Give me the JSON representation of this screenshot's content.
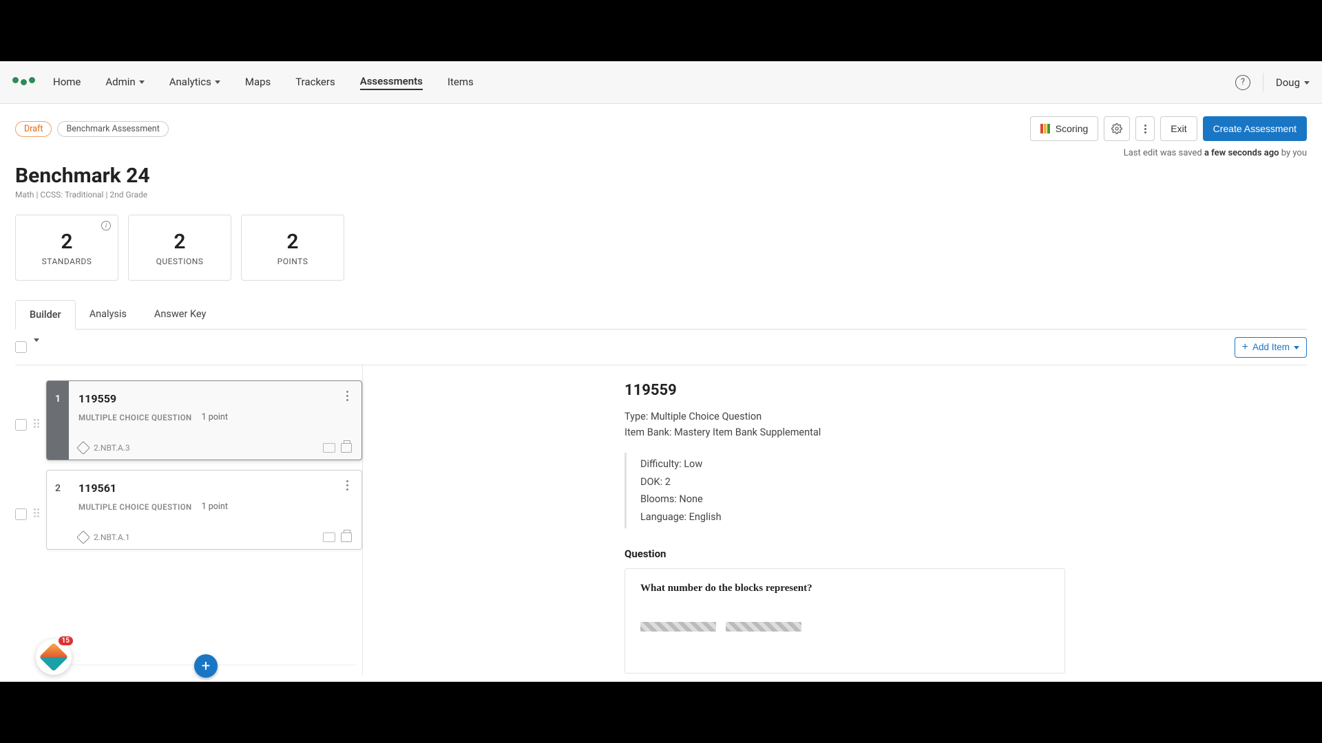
{
  "nav": {
    "items": [
      "Home",
      "Admin",
      "Analytics",
      "Maps",
      "Trackers",
      "Assessments",
      "Items"
    ],
    "dropdown_on": [
      "Admin",
      "Analytics"
    ],
    "active": "Assessments",
    "user": "Doug"
  },
  "actionbar": {
    "draft_label": "Draft",
    "category_label": "Benchmark Assessment",
    "scoring_label": "Scoring",
    "exit_label": "Exit",
    "create_label": "Create Assessment"
  },
  "saved": {
    "prefix": "Last edit was saved ",
    "when": "a few seconds ago",
    "suffix": " by you"
  },
  "header": {
    "title": "Benchmark 24",
    "subtitle": "Math  |  CCSS: Traditional  |  2nd Grade"
  },
  "stats": [
    {
      "value": "2",
      "label": "STANDARDS",
      "info": true
    },
    {
      "value": "2",
      "label": "QUESTIONS",
      "info": false
    },
    {
      "value": "2",
      "label": "POINTS",
      "info": false
    }
  ],
  "tabs": {
    "items": [
      "Builder",
      "Analysis",
      "Answer Key"
    ],
    "active": "Builder"
  },
  "builder": {
    "add_item_label": "Add Item",
    "items": [
      {
        "num": "1",
        "id": "119559",
        "type": "MULTIPLE CHOICE QUESTION",
        "points": "1 point",
        "standard": "2.NBT.A.3",
        "selected": true
      },
      {
        "num": "2",
        "id": "119561",
        "type": "MULTIPLE CHOICE QUESTION",
        "points": "1 point",
        "standard": "2.NBT.A.1",
        "selected": false
      }
    ]
  },
  "detail": {
    "id": "119559",
    "type_line": "Type: Multiple Choice Question",
    "bank_line": "Item Bank: Mastery Item Bank Supplemental",
    "difficulty": "Difficulty: Low",
    "dok": "DOK: 2",
    "blooms": "Blooms: None",
    "language": "Language: English",
    "question_label": "Question",
    "question_text": "What number do the blocks represent?"
  },
  "widget": {
    "count": "15"
  }
}
